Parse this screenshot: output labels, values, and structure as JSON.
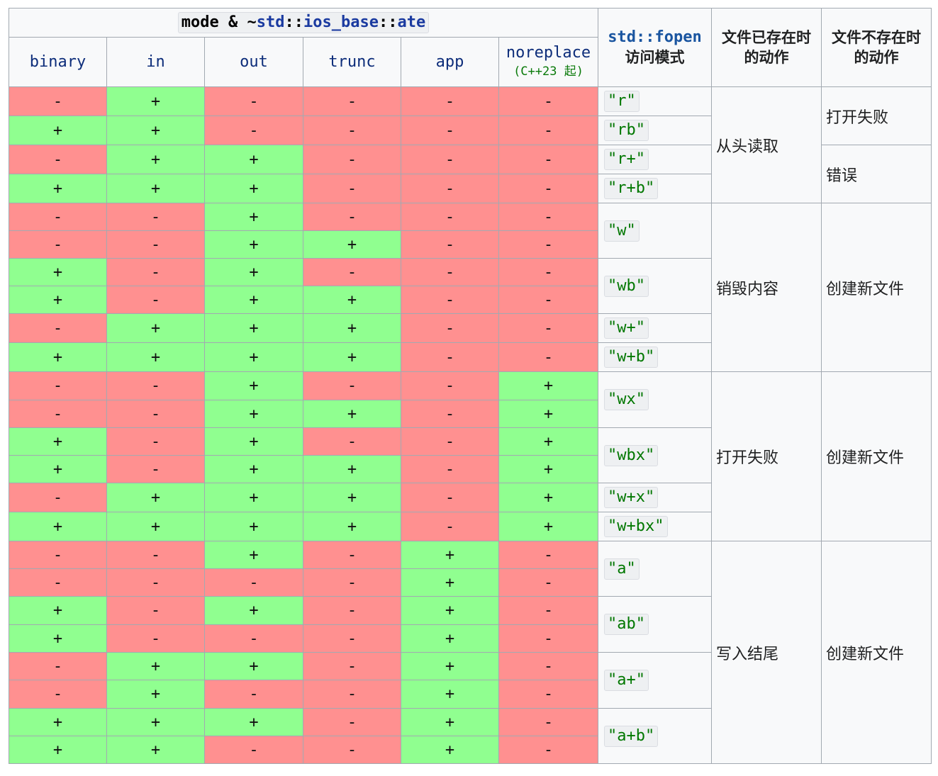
{
  "header": {
    "mode_expr": {
      "mode": "mode",
      "amp": " & ~",
      "ns": "std",
      "sep1": "::",
      "ios": "ios_base",
      "sep2": "::",
      "ate": "ate"
    },
    "flags": [
      "binary",
      "in",
      "out",
      "trunc",
      "app"
    ],
    "noreplace": "noreplace",
    "noreplace_since": "(C++23 起)",
    "fopen_label": "std::fopen",
    "fopen_sub": "访问模式",
    "exists_label_1": "文件已存在时",
    "exists_label_2": "的动作",
    "not_exists_label_1": "文件不存在时",
    "not_exists_label_2": "的动作"
  },
  "rows": [
    [
      "-",
      "+",
      "-",
      "-",
      "-",
      "-"
    ],
    [
      "+",
      "+",
      "-",
      "-",
      "-",
      "-"
    ],
    [
      "-",
      "+",
      "+",
      "-",
      "-",
      "-"
    ],
    [
      "+",
      "+",
      "+",
      "-",
      "-",
      "-"
    ],
    [
      "-",
      "-",
      "+",
      "-",
      "-",
      "-"
    ],
    [
      "-",
      "-",
      "+",
      "+",
      "-",
      "-"
    ],
    [
      "+",
      "-",
      "+",
      "-",
      "-",
      "-"
    ],
    [
      "+",
      "-",
      "+",
      "+",
      "-",
      "-"
    ],
    [
      "-",
      "+",
      "+",
      "+",
      "-",
      "-"
    ],
    [
      "+",
      "+",
      "+",
      "+",
      "-",
      "-"
    ],
    [
      "-",
      "-",
      "+",
      "-",
      "-",
      "+"
    ],
    [
      "-",
      "-",
      "+",
      "+",
      "-",
      "+"
    ],
    [
      "+",
      "-",
      "+",
      "-",
      "-",
      "+"
    ],
    [
      "+",
      "-",
      "+",
      "+",
      "-",
      "+"
    ],
    [
      "-",
      "+",
      "+",
      "+",
      "-",
      "+"
    ],
    [
      "+",
      "+",
      "+",
      "+",
      "-",
      "+"
    ],
    [
      "-",
      "-",
      "+",
      "-",
      "+",
      "-"
    ],
    [
      "-",
      "-",
      "-",
      "-",
      "+",
      "-"
    ],
    [
      "+",
      "-",
      "+",
      "-",
      "+",
      "-"
    ],
    [
      "+",
      "-",
      "-",
      "-",
      "+",
      "-"
    ],
    [
      "-",
      "+",
      "+",
      "-",
      "+",
      "-"
    ],
    [
      "-",
      "+",
      "-",
      "-",
      "+",
      "-"
    ],
    [
      "+",
      "+",
      "+",
      "-",
      "+",
      "-"
    ],
    [
      "+",
      "+",
      "-",
      "-",
      "+",
      "-"
    ]
  ],
  "fopen_modes": [
    "\"r\"",
    "\"rb\"",
    "\"r+\"",
    "\"r+b\"",
    "\"w\"",
    "\"wb\"",
    "\"w+\"",
    "\"w+b\"",
    "\"wx\"",
    "\"wbx\"",
    "\"w+x\"",
    "\"w+bx\"",
    "\"a\"",
    "\"ab\"",
    "\"a+\"",
    "\"a+b\""
  ],
  "actions_exists": [
    "从头读取",
    "销毁内容",
    "打开失败",
    "写入结尾"
  ],
  "actions_not_exists": [
    "打开失败",
    "错误",
    "创建新文件",
    "创建新文件",
    "创建新文件"
  ],
  "colors": {
    "yes": "#90ff90",
    "no": "#ff9090",
    "header_bg": "#f8f9fa",
    "border": "#a2a9b1"
  }
}
